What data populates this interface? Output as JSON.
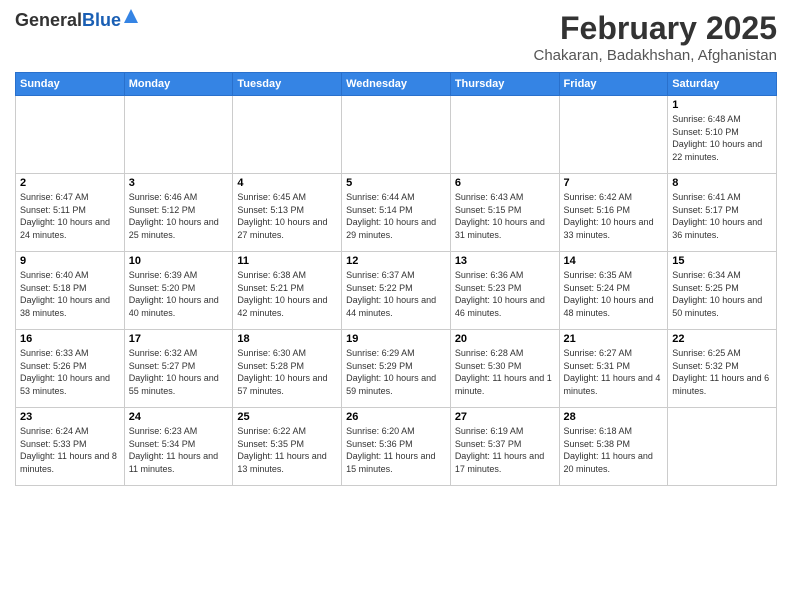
{
  "logo": {
    "general": "General",
    "blue": "Blue"
  },
  "header": {
    "month": "February 2025",
    "location": "Chakaran, Badakhshan, Afghanistan"
  },
  "days_of_week": [
    "Sunday",
    "Monday",
    "Tuesday",
    "Wednesday",
    "Thursday",
    "Friday",
    "Saturday"
  ],
  "weeks": [
    [
      {
        "day": "",
        "info": ""
      },
      {
        "day": "",
        "info": ""
      },
      {
        "day": "",
        "info": ""
      },
      {
        "day": "",
        "info": ""
      },
      {
        "day": "",
        "info": ""
      },
      {
        "day": "",
        "info": ""
      },
      {
        "day": "1",
        "info": "Sunrise: 6:48 AM\nSunset: 5:10 PM\nDaylight: 10 hours and 22 minutes."
      }
    ],
    [
      {
        "day": "2",
        "info": "Sunrise: 6:47 AM\nSunset: 5:11 PM\nDaylight: 10 hours and 24 minutes."
      },
      {
        "day": "3",
        "info": "Sunrise: 6:46 AM\nSunset: 5:12 PM\nDaylight: 10 hours and 25 minutes."
      },
      {
        "day": "4",
        "info": "Sunrise: 6:45 AM\nSunset: 5:13 PM\nDaylight: 10 hours and 27 minutes."
      },
      {
        "day": "5",
        "info": "Sunrise: 6:44 AM\nSunset: 5:14 PM\nDaylight: 10 hours and 29 minutes."
      },
      {
        "day": "6",
        "info": "Sunrise: 6:43 AM\nSunset: 5:15 PM\nDaylight: 10 hours and 31 minutes."
      },
      {
        "day": "7",
        "info": "Sunrise: 6:42 AM\nSunset: 5:16 PM\nDaylight: 10 hours and 33 minutes."
      },
      {
        "day": "8",
        "info": "Sunrise: 6:41 AM\nSunset: 5:17 PM\nDaylight: 10 hours and 36 minutes."
      }
    ],
    [
      {
        "day": "9",
        "info": "Sunrise: 6:40 AM\nSunset: 5:18 PM\nDaylight: 10 hours and 38 minutes."
      },
      {
        "day": "10",
        "info": "Sunrise: 6:39 AM\nSunset: 5:20 PM\nDaylight: 10 hours and 40 minutes."
      },
      {
        "day": "11",
        "info": "Sunrise: 6:38 AM\nSunset: 5:21 PM\nDaylight: 10 hours and 42 minutes."
      },
      {
        "day": "12",
        "info": "Sunrise: 6:37 AM\nSunset: 5:22 PM\nDaylight: 10 hours and 44 minutes."
      },
      {
        "day": "13",
        "info": "Sunrise: 6:36 AM\nSunset: 5:23 PM\nDaylight: 10 hours and 46 minutes."
      },
      {
        "day": "14",
        "info": "Sunrise: 6:35 AM\nSunset: 5:24 PM\nDaylight: 10 hours and 48 minutes."
      },
      {
        "day": "15",
        "info": "Sunrise: 6:34 AM\nSunset: 5:25 PM\nDaylight: 10 hours and 50 minutes."
      }
    ],
    [
      {
        "day": "16",
        "info": "Sunrise: 6:33 AM\nSunset: 5:26 PM\nDaylight: 10 hours and 53 minutes."
      },
      {
        "day": "17",
        "info": "Sunrise: 6:32 AM\nSunset: 5:27 PM\nDaylight: 10 hours and 55 minutes."
      },
      {
        "day": "18",
        "info": "Sunrise: 6:30 AM\nSunset: 5:28 PM\nDaylight: 10 hours and 57 minutes."
      },
      {
        "day": "19",
        "info": "Sunrise: 6:29 AM\nSunset: 5:29 PM\nDaylight: 10 hours and 59 minutes."
      },
      {
        "day": "20",
        "info": "Sunrise: 6:28 AM\nSunset: 5:30 PM\nDaylight: 11 hours and 1 minute."
      },
      {
        "day": "21",
        "info": "Sunrise: 6:27 AM\nSunset: 5:31 PM\nDaylight: 11 hours and 4 minutes."
      },
      {
        "day": "22",
        "info": "Sunrise: 6:25 AM\nSunset: 5:32 PM\nDaylight: 11 hours and 6 minutes."
      }
    ],
    [
      {
        "day": "23",
        "info": "Sunrise: 6:24 AM\nSunset: 5:33 PM\nDaylight: 11 hours and 8 minutes."
      },
      {
        "day": "24",
        "info": "Sunrise: 6:23 AM\nSunset: 5:34 PM\nDaylight: 11 hours and 11 minutes."
      },
      {
        "day": "25",
        "info": "Sunrise: 6:22 AM\nSunset: 5:35 PM\nDaylight: 11 hours and 13 minutes."
      },
      {
        "day": "26",
        "info": "Sunrise: 6:20 AM\nSunset: 5:36 PM\nDaylight: 11 hours and 15 minutes."
      },
      {
        "day": "27",
        "info": "Sunrise: 6:19 AM\nSunset: 5:37 PM\nDaylight: 11 hours and 17 minutes."
      },
      {
        "day": "28",
        "info": "Sunrise: 6:18 AM\nSunset: 5:38 PM\nDaylight: 11 hours and 20 minutes."
      },
      {
        "day": "",
        "info": ""
      }
    ]
  ]
}
